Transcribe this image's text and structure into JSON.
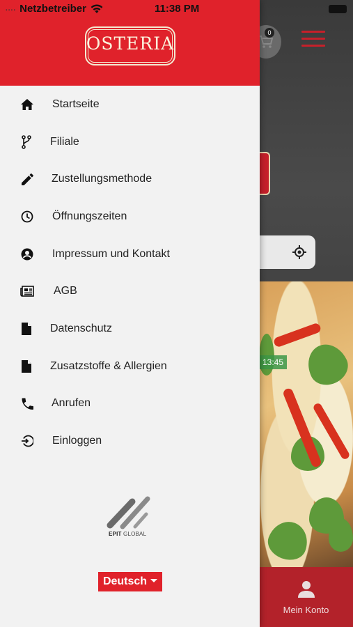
{
  "status_bar": {
    "signal_dots": "....",
    "carrier": "Netzbetreiber",
    "time": "11:38 PM"
  },
  "drawer": {
    "logo_text": "OSTERIA",
    "menu": [
      {
        "label": "Startseite",
        "icon": "home-icon"
      },
      {
        "label": "Filiale",
        "icon": "branch-icon"
      },
      {
        "label": "Zustellungsmethode",
        "icon": "pencil-icon"
      },
      {
        "label": "Öffnungszeiten",
        "icon": "clock-icon"
      },
      {
        "label": "Impressum und Kontakt",
        "icon": "account-circle-icon"
      },
      {
        "label": "AGB",
        "icon": "newspaper-icon"
      },
      {
        "label": "Datenschutz",
        "icon": "document-icon"
      },
      {
        "label": "Zusatzstoffe & Allergien",
        "icon": "document-icon"
      },
      {
        "label": "Anrufen",
        "icon": "phone-icon"
      },
      {
        "label": "Einloggen",
        "icon": "login-icon"
      }
    ],
    "footer_brand": {
      "strong": "EPIT",
      "rest": " GLOBAL"
    },
    "language": "Deutsch"
  },
  "background": {
    "cart_count": "0",
    "time_badge": "13:45",
    "account_label": "Mein Konto"
  },
  "colors": {
    "brand_red": "#e0222b",
    "drawer_bg": "#f2f2f2"
  }
}
